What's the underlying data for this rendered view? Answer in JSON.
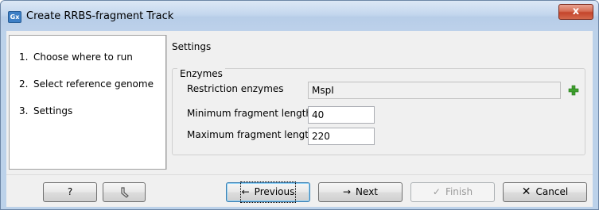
{
  "window": {
    "icon_text": "Gx",
    "title": "Create RRBS-fragment Track",
    "close_glyph": "x"
  },
  "steps": [
    {
      "num": "1.",
      "label": "Choose where to run"
    },
    {
      "num": "2.",
      "label": "Select reference genome"
    },
    {
      "num": "3.",
      "label": "Settings"
    }
  ],
  "settings": {
    "section_title": "Settings",
    "group_title": "Enzymes",
    "restriction_enzymes_label": "Restriction enzymes",
    "restriction_enzymes_value": "MspI",
    "min_fragment_label": "Minimum fragment length",
    "min_fragment_value": "40",
    "max_fragment_label": "Maximum fragment length",
    "max_fragment_value": "220",
    "add_icon": "plus-icon"
  },
  "buttons": {
    "help": "?",
    "reset_icon": "reset-icon",
    "previous": "Previous",
    "next": "Next",
    "finish": "Finish",
    "cancel": "Cancel"
  }
}
